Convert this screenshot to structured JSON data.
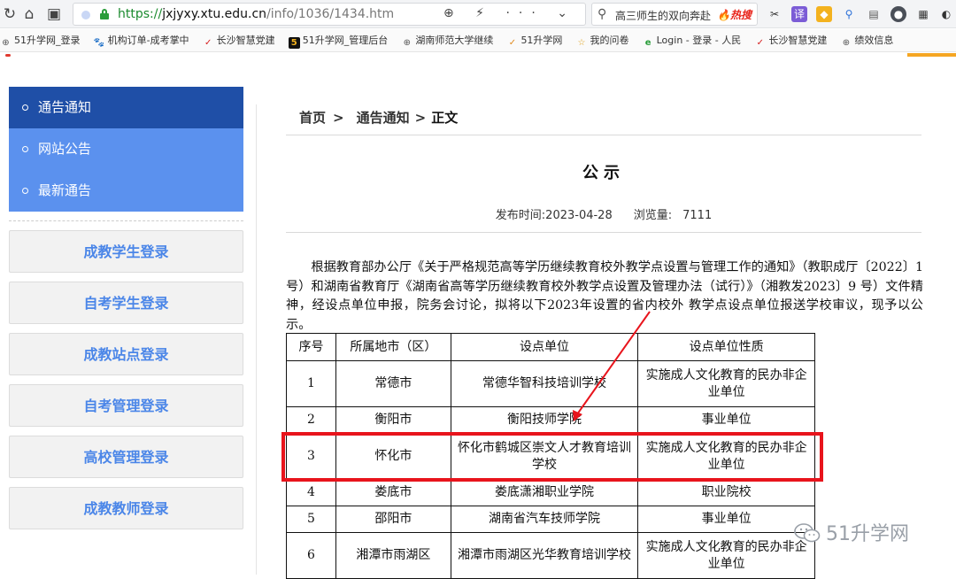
{
  "browser": {
    "url_scheme": "https://",
    "url_host": "jxjyxy.xtu.edu.cn",
    "url_path": "/info/1036/1434.htm",
    "url_tools": "⊕ ⚡ ··· ⌄",
    "search_text": "高三师生的双向奔赴",
    "search_hot": "🔥热搜",
    "bookmarks": [
      {
        "icon": "⊕",
        "label": "51升学网_登录"
      },
      {
        "icon": "🐾",
        "label": "机构订单-成考掌中"
      },
      {
        "icon": "✓",
        "label": "长沙智慧党建"
      },
      {
        "icon": "5",
        "label": "51升学网_管理后台"
      },
      {
        "icon": "⊕",
        "label": "湖南师范大学继续"
      },
      {
        "icon": "✓",
        "label": "51升学网"
      },
      {
        "icon": "☆",
        "label": "我的问卷"
      },
      {
        "icon": "e",
        "label": "Login - 登录 - 人民"
      },
      {
        "icon": "✓",
        "label": "长沙智慧党建"
      },
      {
        "icon": "⊕",
        "label": "绩效信息"
      }
    ]
  },
  "sidebar": {
    "menu": [
      {
        "label": "通告通知",
        "active": true
      },
      {
        "label": "网站公告",
        "active": false
      },
      {
        "label": "最新通告",
        "active": false
      }
    ],
    "logins": [
      {
        "label": "成教学生登录"
      },
      {
        "label": "自考学生登录"
      },
      {
        "label": "成教站点登录"
      },
      {
        "label": "自考管理登录"
      },
      {
        "label": "高校管理登录"
      },
      {
        "label": "成教教师登录"
      }
    ]
  },
  "breadcrumb": {
    "home": "首页",
    "section": "通告通知",
    "current": "正文",
    "separator": ">"
  },
  "article": {
    "title": "公示",
    "published_label": "发布时间:",
    "published_date": "2023-04-28",
    "views_label": "浏览量:",
    "views": "7111",
    "body": "根据教育部办公厅《关于严格规范高等学历继续教育校外教学点设置与管理工作的通知》（教职成厅〔2022〕1 号）和湖南省教育厅《湖南省高等学历继续教育校外教学点设置及管理办法（试行）》（湘教发2023〕9 号）文件精神，经设点单位申报，院务会讨论，拟将以下2023年设置的省内校外 教学点设点单位报送学校审议，现予以公示。"
  },
  "table": {
    "headers": [
      "序号",
      "所属地市（区）",
      "设点单位",
      "设点单位性质"
    ],
    "rows": [
      [
        "1",
        "常德市",
        "常德华智科技培训学校",
        "实施成人文化教育的民办非企业单位"
      ],
      [
        "2",
        "衡阳市",
        "衡阳技师学院",
        "事业单位"
      ],
      [
        "3",
        "怀化市",
        "怀化市鹤城区崇文人才教育培训学校",
        "实施成人文化教育的民办非企业单位"
      ],
      [
        "4",
        "娄底市",
        "娄底潇湘职业学院",
        "职业院校"
      ],
      [
        "5",
        "邵阳市",
        "湖南省汽车技师学院",
        "事业单位"
      ],
      [
        "6",
        "湘潭市雨湖区",
        "湘潭市雨湖区光华教育培训学校",
        "实施成人文化教育的民办非企业单位"
      ]
    ],
    "highlighted_row": 3
  },
  "watermark": {
    "text": "51升学网"
  },
  "colors": {
    "sidebar_active": "#1f4fa7",
    "sidebar_bg": "#5b91ee",
    "login_text": "#4b86e8",
    "highlight": "#e8141c"
  }
}
